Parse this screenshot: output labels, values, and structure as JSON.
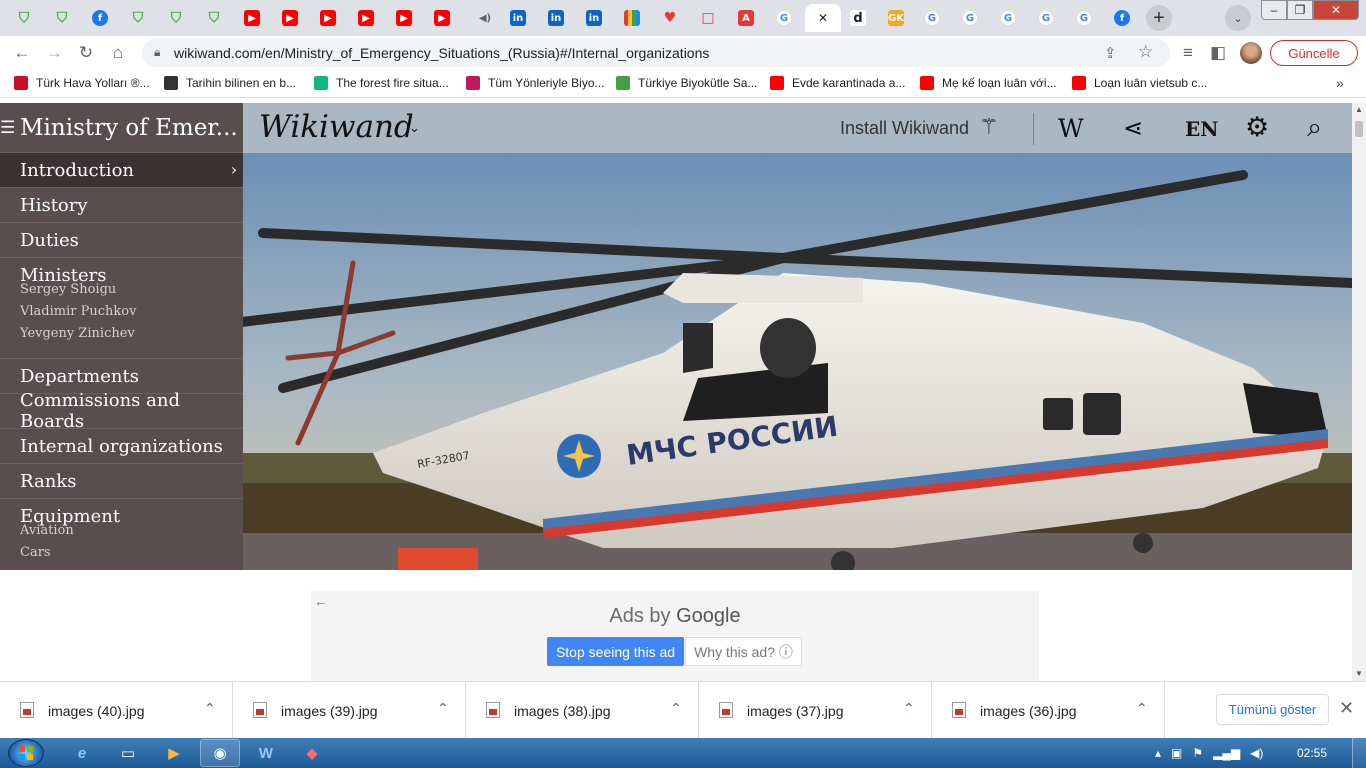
{
  "tabs": [
    {
      "icon": "shield-icon",
      "color": "#4caf50"
    },
    {
      "icon": "shield-icon",
      "color": "#4caf50"
    },
    {
      "icon": "facebook-icon",
      "color": "#1877f2",
      "glyph": "f"
    },
    {
      "icon": "shield-icon",
      "color": "#4caf50"
    },
    {
      "icon": "shield-icon",
      "color": "#4caf50"
    },
    {
      "icon": "shield-icon",
      "color": "#4caf50"
    },
    {
      "icon": "youtube-icon",
      "color": "#ff0000",
      "glyph": "▶"
    },
    {
      "icon": "youtube-icon",
      "color": "#ff0000",
      "glyph": "▶"
    },
    {
      "icon": "youtube-icon",
      "color": "#ff0000",
      "glyph": "▶"
    },
    {
      "icon": "youtube-icon",
      "color": "#ff0000",
      "glyph": "▶"
    },
    {
      "icon": "youtube-icon",
      "color": "#ff0000",
      "glyph": "▶"
    },
    {
      "icon": "youtube-icon",
      "color": "#ff0000",
      "glyph": "▶"
    },
    {
      "icon": "audio-playing-icon",
      "color": "#5f6368",
      "glyph": "◀)"
    },
    {
      "icon": "linkedin-icon",
      "color": "#0a66c2",
      "glyph": "in"
    },
    {
      "icon": "linkedin-icon",
      "color": "#0a66c2",
      "glyph": "in"
    },
    {
      "icon": "linkedin-icon",
      "color": "#0a66c2",
      "glyph": "in"
    },
    {
      "icon": "colorful-grid-icon",
      "color": "#e91e63"
    },
    {
      "icon": "heart-icon",
      "color": "#e53935",
      "glyph": "♥"
    },
    {
      "icon": "square-outline-icon",
      "color": "#e53935",
      "glyph": "□"
    },
    {
      "icon": "adobe-icon",
      "color": "#e53935",
      "glyph": "A"
    },
    {
      "icon": "google-icon",
      "color": "#4285f4",
      "glyph": "G"
    },
    {
      "icon": "close-icon",
      "color": "#202124",
      "glyph": "✕",
      "active": true
    },
    {
      "icon": "d-icon",
      "color": "#202124",
      "glyph": "d"
    },
    {
      "icon": "gk-icon",
      "color": "#f5a623",
      "glyph": "GK"
    },
    {
      "icon": "google-icon",
      "color": "#4285f4",
      "glyph": "G"
    },
    {
      "icon": "google-icon",
      "color": "#4285f4",
      "glyph": "G"
    },
    {
      "icon": "google-icon",
      "color": "#4285f4",
      "glyph": "G"
    },
    {
      "icon": "google-icon",
      "color": "#4285f4",
      "glyph": "G"
    },
    {
      "icon": "google-translate-icon",
      "color": "#4285f4",
      "glyph": "G"
    },
    {
      "icon": "facebook-icon",
      "color": "#1877f2",
      "glyph": "f"
    }
  ],
  "toolbar": {
    "url": "wikiwand.com/en/Ministry_of_Emergency_Situations_(Russia)#/Internal_organizations",
    "update_label": "Güncelle"
  },
  "bookmarks": [
    {
      "label": "Türk Hava Yolları ®...",
      "color": "#c8102e"
    },
    {
      "label": "Tarihin bilinen en b...",
      "color": "#333333"
    },
    {
      "label": "The forest fire situa...",
      "color": "#10b981"
    },
    {
      "label": "Tüm Yönleriyle Biyo...",
      "color": "#c2185b"
    },
    {
      "label": "Türkiye Biyokütle Sa...",
      "color": "#43a047"
    },
    {
      "label": "Evde karantinada a...",
      "color": "#ff0000"
    },
    {
      "label": "Mẹ kế loạn luân với...",
      "color": "#ff0000"
    },
    {
      "label": "Loạn luân vietsub c...",
      "color": "#ff0000"
    }
  ],
  "sidebar": {
    "title": "Ministry of Emer...",
    "items": [
      {
        "label": "Introduction",
        "active": true
      },
      {
        "label": "History"
      },
      {
        "label": "Duties"
      },
      {
        "label": "Ministers",
        "subs": [
          "Sergey Shoigu",
          "Vladimir Puchkov",
          "Yevgeny Zinichev"
        ]
      },
      {
        "label": "Departments"
      },
      {
        "label": "Commissions and Boards"
      },
      {
        "label": "Internal organizations"
      },
      {
        "label": "Ranks"
      },
      {
        "label": "Equipment",
        "subs": [
          "Aviation",
          "Cars"
        ]
      }
    ]
  },
  "header": {
    "logo": "Wikiwand",
    "install_label": "Install Wikiwand",
    "wikipedia_label": "W",
    "language_label": "EN"
  },
  "hero": {
    "fuselage_text": "МЧС РОССИИ",
    "registration": "RF-32807"
  },
  "ad": {
    "title_prefix": "Ads by ",
    "title_brand": "Google",
    "stop_label": "Stop seeing this ad",
    "why_label": "Why this ad? ⓘ"
  },
  "downloads": {
    "items": [
      "images (40).jpg",
      "images (39).jpg",
      "images (38).jpg",
      "images (37).jpg",
      "images (36).jpg"
    ],
    "show_all_label": "Tümünü göster"
  },
  "taskbar": {
    "clock": "02:55"
  }
}
